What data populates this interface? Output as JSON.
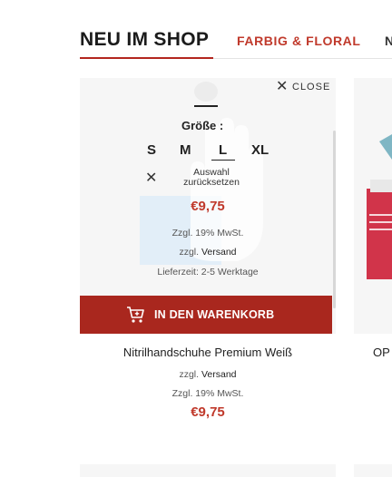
{
  "tabs": {
    "active": "NEU IM SHOP",
    "second": "FARBIG & FLORAL",
    "third_partial": "N"
  },
  "quick_view": {
    "close_label": "CLOSE",
    "size_label": "Größe :",
    "sizes": [
      "S",
      "M",
      "L",
      "XL"
    ],
    "selected_size": "L",
    "reset_label": "Auswahl zurücksetzen",
    "price": "€9,75",
    "tax": "Zzgl. 19% MwSt.",
    "shipping_prefix": "zzgl.",
    "shipping_link": "Versand",
    "delivery": "Lieferzeit: 2-5 Werktage",
    "add_to_cart": "IN DEN WARENKORB"
  },
  "product": {
    "name": "Nitrilhandschuhe Premium Weiß",
    "shipping_prefix": "zzgl.",
    "shipping_link": "Versand",
    "tax": "Zzgl. 19% MwSt.",
    "price": "€9,75"
  },
  "next_product": {
    "name_partial": "OP"
  },
  "colors": {
    "accent": "#c0392b",
    "cart_button": "#a9271e",
    "card_bg": "#f6f6f6"
  }
}
